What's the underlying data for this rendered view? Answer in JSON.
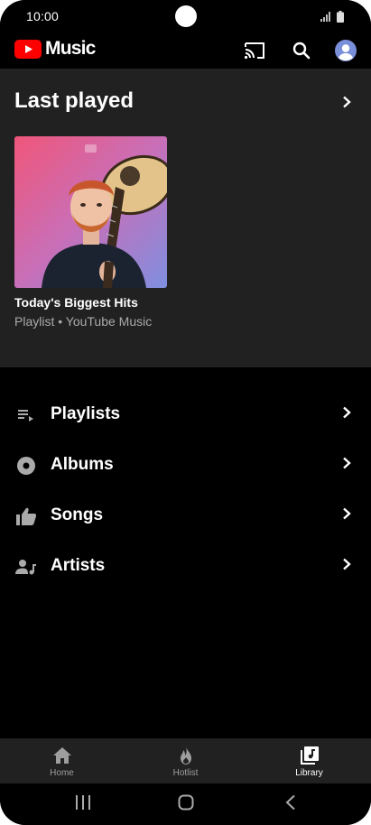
{
  "status_bar": {
    "time": "10:00"
  },
  "app": {
    "logo_text": "Music"
  },
  "last_played": {
    "title": "Last played",
    "card": {
      "title": "Today's Biggest Hits",
      "subtitle": "Playlist • YouTube Music"
    }
  },
  "library": {
    "items": [
      {
        "label": "Playlists",
        "icon": "playlist-icon"
      },
      {
        "label": "Albums",
        "icon": "album-icon"
      },
      {
        "label": "Songs",
        "icon": "thumb-up-icon"
      },
      {
        "label": "Artists",
        "icon": "artist-icon"
      }
    ]
  },
  "bottom_nav": {
    "items": [
      {
        "label": "Home",
        "icon": "home-icon",
        "active": false
      },
      {
        "label": "Hotlist",
        "icon": "flame-icon",
        "active": false
      },
      {
        "label": "Library",
        "icon": "library-music-icon",
        "active": true
      }
    ]
  },
  "colors": {
    "background": "#000000",
    "surface": "#212121",
    "brand_red": "#FF0000",
    "secondary_text": "#AAAAAA",
    "nav_inactive": "#9E9E9E",
    "avatar_blue": "#7A8FD9"
  }
}
